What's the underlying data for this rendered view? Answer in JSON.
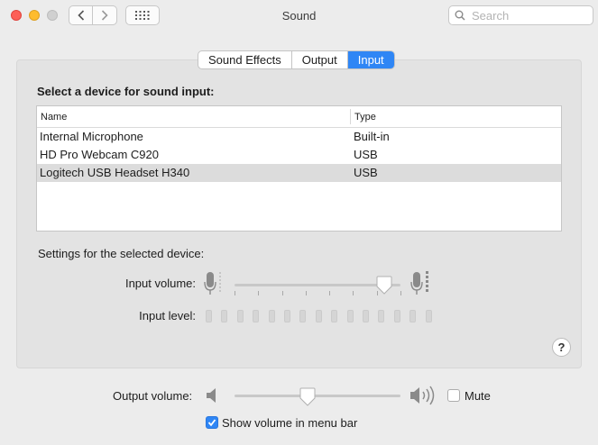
{
  "window": {
    "title": "Sound"
  },
  "toolbar": {
    "search_placeholder": "Search",
    "back_icon": "chevron-left-icon",
    "forward_icon": "chevron-right-icon",
    "show_all_icon": "grid-icon"
  },
  "tabs": [
    {
      "label": "Sound Effects",
      "active": false
    },
    {
      "label": "Output",
      "active": false
    },
    {
      "label": "Input",
      "active": true
    }
  ],
  "input": {
    "heading": "Select a device for sound input:",
    "columns": {
      "name": "Name",
      "type": "Type"
    },
    "devices": [
      {
        "name": "Internal Microphone",
        "type": "Built-in",
        "selected": false
      },
      {
        "name": "HD Pro Webcam C920",
        "type": "USB",
        "selected": false
      },
      {
        "name": "Logitech USB Headset H340",
        "type": "USB",
        "selected": true
      }
    ],
    "settings_label": "Settings for the selected device:",
    "input_volume_label": "Input volume:",
    "input_volume_value": 0.9,
    "input_level_label": "Input level:",
    "input_level_segments": 15,
    "input_level_active": 0,
    "help_label": "?"
  },
  "output": {
    "volume_label": "Output volume:",
    "volume_value": 0.44,
    "mute_label": "Mute",
    "mute_checked": false,
    "show_volume_label": "Show volume in menu bar",
    "show_volume_checked": true
  },
  "colors": {
    "accent": "#2f86f5",
    "panel": "#e3e3e3",
    "window": "#ececec"
  }
}
